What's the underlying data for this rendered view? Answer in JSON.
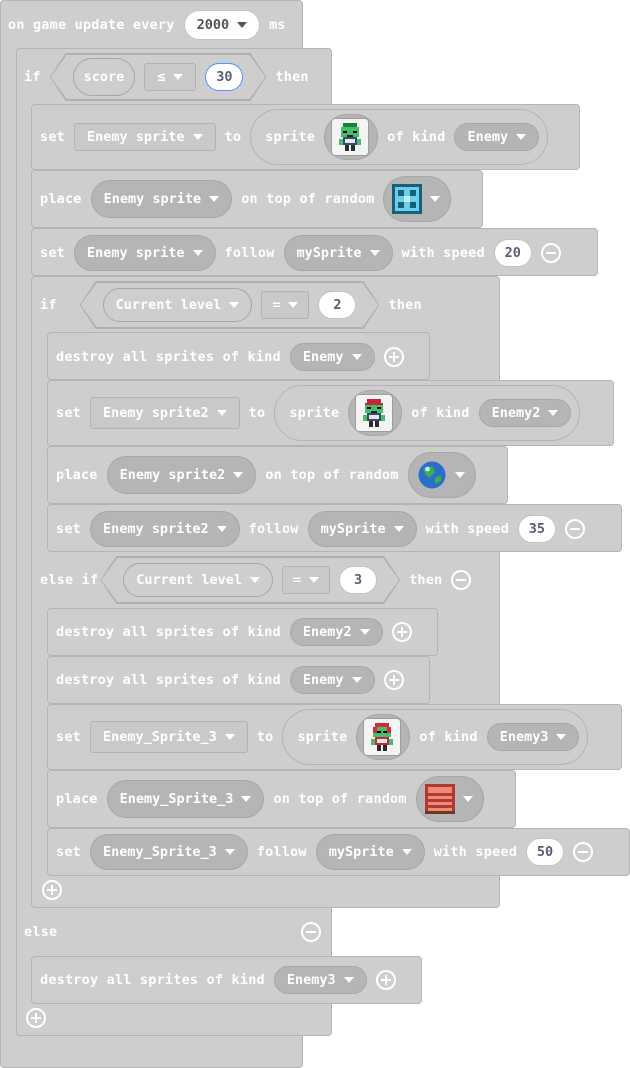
{
  "event": {
    "prefix": "on game update every",
    "interval": "2000",
    "unit": "ms"
  },
  "kw": {
    "if": "if",
    "then": "then",
    "set": "set",
    "to": "to",
    "sprite": "sprite",
    "of_kind": "of kind",
    "place": "place",
    "on_top_of_random": "on top of random",
    "follow": "follow",
    "with_speed": "with speed",
    "destroy_all": "destroy all sprites of kind",
    "else_if": "else if",
    "else": "else"
  },
  "cond_score": {
    "var": "score",
    "op": "≤",
    "value": "30"
  },
  "cond_level2": {
    "var": "Current level",
    "op": "=",
    "value": "2"
  },
  "cond_level3": {
    "var": "Current level",
    "op": "=",
    "value": "3"
  },
  "vars": {
    "enemy": "Enemy sprite",
    "enemy2": "Enemy sprite2",
    "enemy3": "Enemy_Sprite_3",
    "player": "mySprite"
  },
  "kinds": {
    "enemy": "Enemy",
    "enemy2": "Enemy2",
    "enemy3": "Enemy3"
  },
  "speeds": {
    "s1": "20",
    "s2": "35",
    "s3": "50"
  },
  "icons": {
    "add": "add-circle-icon",
    "remove": "remove-circle-icon",
    "dropdown": "dropdown-arrow-icon",
    "zombie1": "green-zombie-sprite",
    "zombie2": "red-hair-zombie-sprite",
    "zombie3": "red-zombie-sprite",
    "tile_blue": "blue-pattern-tile",
    "tile_planet": "planet-tile",
    "tile_chest": "chest-tile"
  },
  "colors": {
    "block": "#cecece",
    "dropdown": "#b5b5b5",
    "text": "#ffffff",
    "value_text": "#575e75",
    "selected_outline": "#4d97ff"
  }
}
